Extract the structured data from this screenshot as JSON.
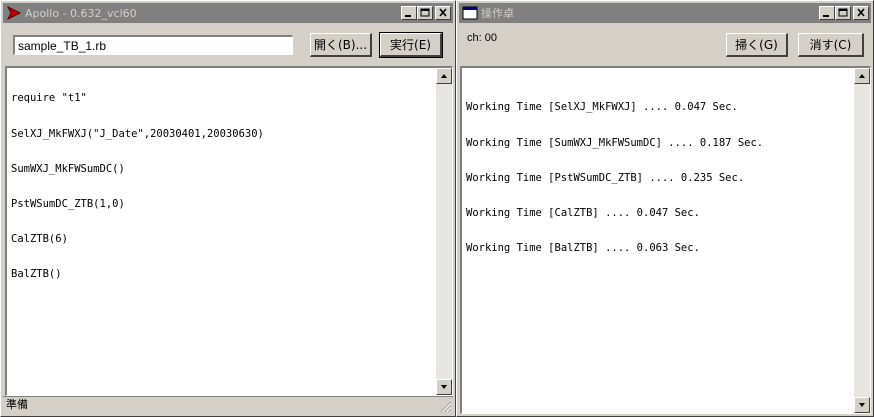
{
  "left_window": {
    "title": "Apollo - 0.632_vcl60",
    "file_input": "sample_TB_1.rb",
    "open_button": "開く(B)...",
    "run_button": "実行(E)",
    "editor_lines": [
      "require \"t1\"",
      "SelXJ_MkFWXJ(\"J_Date\",20030401,20030630)",
      "SumWXJ_MkFWSumDC()",
      "PstWSumDC_ZTB(1,0)",
      "CalZTB(6)",
      "BalZTB()"
    ],
    "status": "準備"
  },
  "right_window": {
    "title": "操作卓",
    "ch_label": "ch: 00",
    "sweep_button": "掃く(G)",
    "clear_button": "消す(C)",
    "output_lines": [
      "Working Time [SelXJ_MkFWXJ] .... 0.047 Sec.",
      "Working Time [SumWXJ_MkFWSumDC] .... 0.187 Sec.",
      "Working Time [PstWSumDC_ZTB] .... 0.235 Sec.",
      "Working Time [CalZTB] .... 0.047 Sec.",
      "Working Time [BalZTB] .... 0.063 Sec."
    ]
  },
  "icons": {
    "app": "apollo-app-icon",
    "console": "window-app-icon",
    "minimize": "minimize-icon",
    "maximize": "maximize-icon",
    "close": "close-icon",
    "scroll_up": "arrow-up-icon",
    "scroll_down": "arrow-down-icon"
  },
  "colors": {
    "face": "#d4d0c8",
    "inactive_title": "#808080",
    "app_icon": "#c00000"
  }
}
